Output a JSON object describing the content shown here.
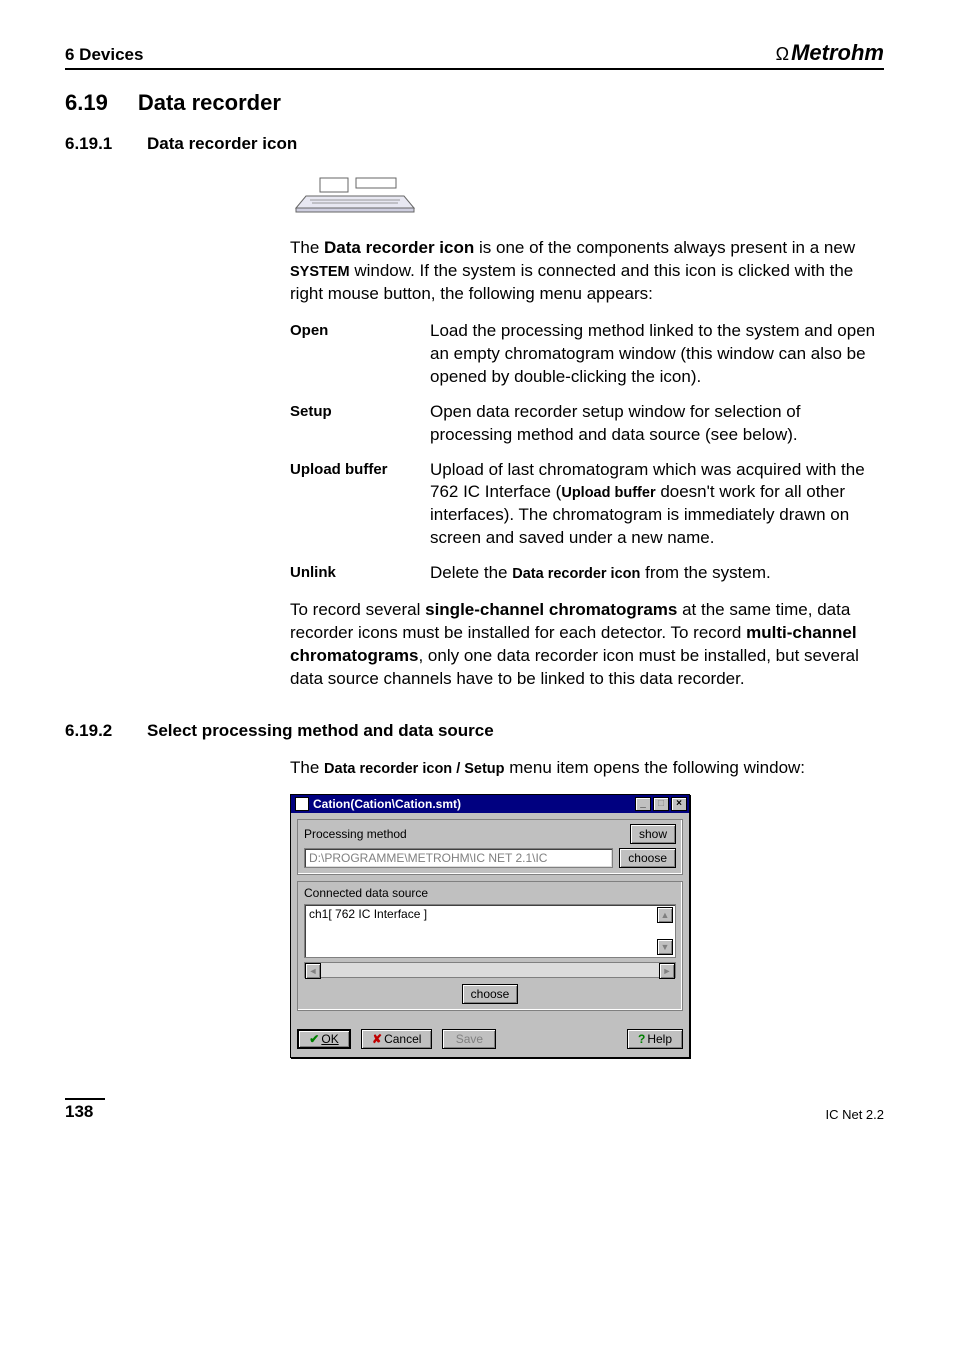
{
  "header": {
    "chapter": "6  Devices",
    "brand": "Metrohm"
  },
  "section": {
    "num": "6.19",
    "title": "Data recorder"
  },
  "sub1": {
    "num": "6.19.1",
    "title": "Data recorder icon",
    "intro1_pre": "The ",
    "intro1_bold1": "Data recorder icon",
    "intro1_mid1": " is one of the components always present in a new ",
    "intro1_bold2": "SYSTEM",
    "intro1_post": " window. If the system is connected and this icon is clicked with the right mouse button, the following menu appears:",
    "defs": [
      {
        "term": "Open",
        "desc": "Load the processing method linked to the system and open an empty chromatogram window (this window can also be opened by double-clicking the icon)."
      },
      {
        "term": "Setup",
        "desc": "Open data recorder setup window for selection of processing method and data source (see below)."
      }
    ],
    "upload": {
      "term": "Upload buffer",
      "pre": "Upload of last chromatogram which was acquired with the 762 IC Interface (",
      "bold": "Upload buffer",
      "post": " doesn't work for all other interfaces). The chromatogram is immediately drawn on screen and saved under a new name."
    },
    "unlink": {
      "term": "Unlink",
      "pre": "Delete the ",
      "bold": "Data recorder icon",
      "post": " from the system."
    },
    "trail_pre": "To record several ",
    "trail_b1": "single-channel chromatograms",
    "trail_mid": " at the same time, data recorder icons must be installed for each detector. To record ",
    "trail_b2": "multi-channel chromatograms",
    "trail_post": ", only one data recorder icon must be installed, but several data source channels have to be linked to this data recorder."
  },
  "sub2": {
    "num": "6.19.2",
    "title": "Select processing method and data source",
    "intro_pre": "The ",
    "intro_b1": "Data recorder icon / Setup",
    "intro_post": " menu item opens the following window:"
  },
  "dialog": {
    "title": "Cation(Cation\\Cation.smt)",
    "pm_label": "Processing method",
    "pm_value": "D:\\PROGRAMME\\METROHM\\IC NET 2.1\\IC",
    "show": "show",
    "choose": "choose",
    "ds_label": "Connected  data source",
    "ds_item": "ch1[ 762 IC Interface ]",
    "choose2": "choose",
    "ok": "OK",
    "cancel": "Cancel",
    "save": "Save",
    "help": "Help"
  },
  "footer": {
    "page": "138",
    "product": "IC Net 2.2"
  }
}
